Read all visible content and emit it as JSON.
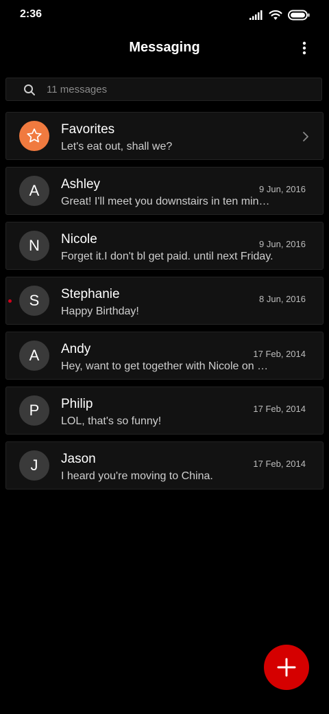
{
  "status_bar": {
    "time": "2:36",
    "icons": [
      "signal-icon",
      "wifi-icon",
      "battery-icon"
    ]
  },
  "header": {
    "title": "Messaging",
    "menu_icon": "more-vert-icon"
  },
  "search": {
    "icon": "search-icon",
    "placeholder": "11 messages"
  },
  "favorites": {
    "name": "Favorites",
    "preview": "Let's eat out, shall we?",
    "icon": "star-icon",
    "avatar_color": "#f07a3f"
  },
  "conversations": [
    {
      "initial": "A",
      "name": "Ashley",
      "date": "9 Jun, 2016",
      "preview": "Great! I'll meet you downstairs in ten minutes."
    },
    {
      "initial": "N",
      "name": "Nicole",
      "date": "9 Jun, 2016",
      "preview": "Forget it.I don't bl get paid. until next Friday."
    },
    {
      "initial": "S",
      "name": "Stephanie",
      "date": "8 Jun, 2016",
      "preview": "Happy Birthday!",
      "unread": true
    },
    {
      "initial": "A",
      "name": "Andy",
      "date": "17 Feb, 2014",
      "preview": "Hey, want to get together with Nicole on Friday?"
    },
    {
      "initial": "P",
      "name": "Philip",
      "date": "17 Feb, 2014",
      "preview": "LOL, that's so funny!"
    },
    {
      "initial": "J",
      "name": "Jason",
      "date": "17 Feb, 2014",
      "preview": "I heard you're moving to China."
    }
  ],
  "fab": {
    "icon": "plus-icon",
    "color": "#d50000"
  },
  "colors": {
    "background": "#000000",
    "card": "#121212",
    "avatar": "#3a3a3a",
    "unread_dot": "#d0021b"
  }
}
